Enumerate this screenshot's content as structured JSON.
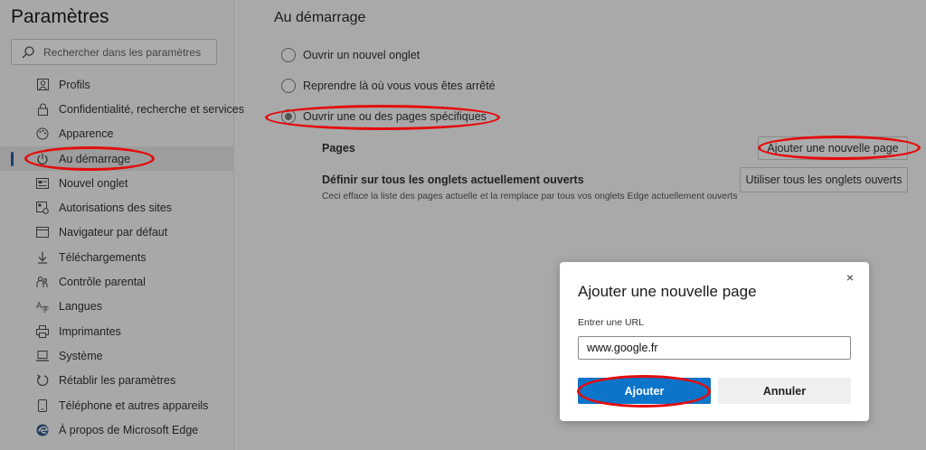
{
  "sidebar": {
    "title": "Paramètres",
    "search_placeholder": "Rechercher dans les paramètres",
    "items": [
      {
        "label": "Profils",
        "icon": "profile-icon"
      },
      {
        "label": "Confidentialité, recherche et services",
        "icon": "lock-icon"
      },
      {
        "label": "Apparence",
        "icon": "palette-icon"
      },
      {
        "label": "Au démarrage",
        "icon": "power-icon"
      },
      {
        "label": "Nouvel onglet",
        "icon": "new-tab-icon"
      },
      {
        "label": "Autorisations des sites",
        "icon": "site-permissions-icon"
      },
      {
        "label": "Navigateur par défaut",
        "icon": "browser-icon"
      },
      {
        "label": "Téléchargements",
        "icon": "download-icon"
      },
      {
        "label": "Contrôle parental",
        "icon": "family-icon"
      },
      {
        "label": "Langues",
        "icon": "language-icon"
      },
      {
        "label": "Imprimantes",
        "icon": "printer-icon"
      },
      {
        "label": "Système",
        "icon": "computer-icon"
      },
      {
        "label": "Rétablir les paramètres",
        "icon": "reset-icon"
      },
      {
        "label": "Téléphone et autres appareils",
        "icon": "phone-icon"
      },
      {
        "label": "À propos de Microsoft Edge",
        "icon": "edge-icon"
      }
    ],
    "active_item": "Au démarrage"
  },
  "main": {
    "section_title": "Au démarrage",
    "options": [
      {
        "label": "Ouvrir un nouvel onglet",
        "checked": false
      },
      {
        "label": "Reprendre là où vous vous êtes arrêté",
        "checked": false
      },
      {
        "label": "Ouvrir une ou des pages spécifiques",
        "checked": true
      }
    ],
    "pages_label": "Pages",
    "add_page_button": "Ajouter une nouvelle page",
    "define_label": "Définir sur tous les onglets actuellement ouverts",
    "define_desc": "Ceci efface la liste des pages actuelle et la remplace par tous vos onglets Edge actuellement ouverts",
    "use_all_button": "Utiliser tous les onglets ouverts"
  },
  "dialog": {
    "title": "Ajouter une nouvelle page",
    "close_icon": "×",
    "url_label": "Entrer une URL",
    "url_value": "www.google.fr",
    "confirm_button": "Ajouter",
    "cancel_button": "Annuler"
  },
  "colors": {
    "annotation": "#e40c0c",
    "primary": "#0c75c9",
    "overlay_background": "#a9a9a9"
  }
}
